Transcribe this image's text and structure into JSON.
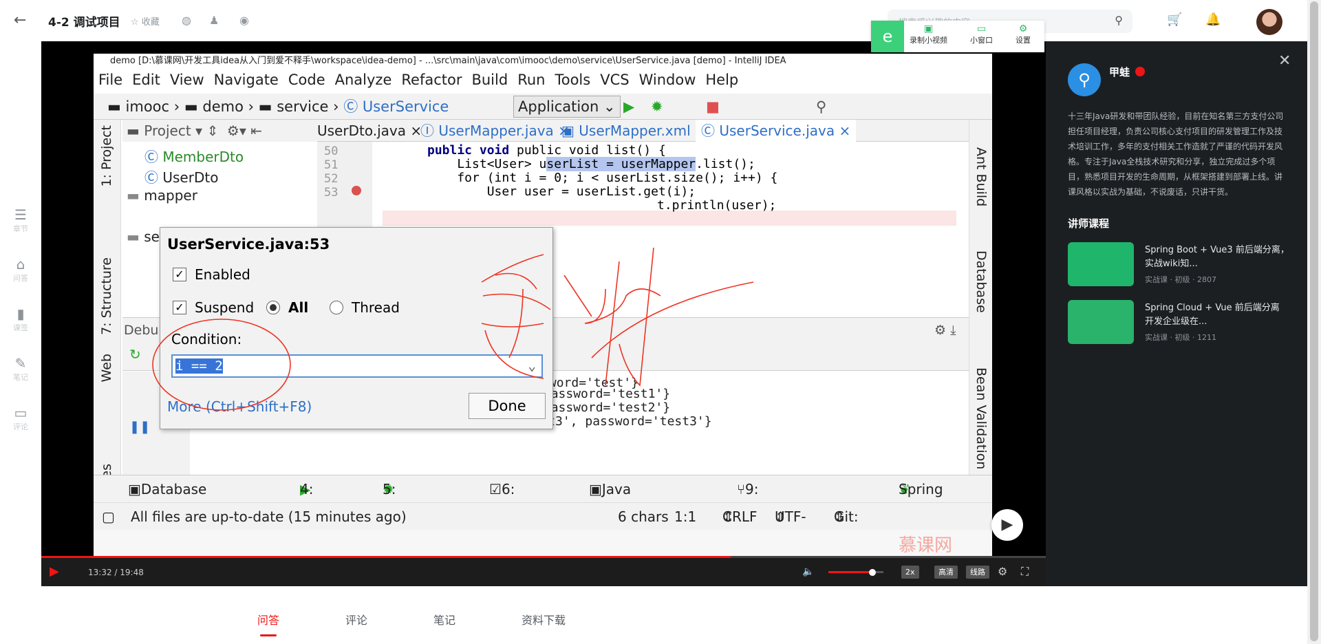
{
  "header": {
    "title": "4-2 调试项目",
    "collect": "☆ 收藏",
    "search_placeholder": "搜索感兴趣的内容"
  },
  "recorder": {
    "record": "录制小视频",
    "mini": "小窗口",
    "settings": "设置"
  },
  "left_sidebar": [
    {
      "label": "章节",
      "icon": "chapter-icon"
    },
    {
      "label": "问答",
      "icon": "qa-icon"
    },
    {
      "label": "课签",
      "icon": "tag-icon"
    },
    {
      "label": "笔记",
      "icon": "note-icon"
    },
    {
      "label": "评论",
      "icon": "comment-icon"
    }
  ],
  "ide": {
    "window_title": "demo [D:\\慕课网\\开发工具idea从入门到爱不释手\\workspace\\idea-demo] - ...\\src\\main\\java\\com\\imooc\\demo\\service\\UserService.java [demo] - IntelliJ IDEA",
    "menu": [
      "File",
      "Edit",
      "View",
      "Navigate",
      "Code",
      "Analyze",
      "Refactor",
      "Build",
      "Run",
      "Tools",
      "VCS",
      "Window",
      "Help"
    ],
    "breadcrumb": [
      "imooc",
      "demo",
      "service",
      "UserService"
    ],
    "run_config": "Application",
    "project_label": "Project",
    "tabs": [
      "UserDto.java",
      "UserMapper.java",
      "UserMapper.xml",
      "UserService.java"
    ],
    "tree": [
      "MemberDto",
      "UserDto",
      "mapper",
      "se"
    ],
    "line_numbers": [
      "50",
      "51",
      "52",
      "53"
    ],
    "code": {
      "l50": "public void list() {",
      "l51a": "    List<User> u",
      "l51b": "serList = ",
      "l51c": "userMapper",
      "l51d": ".list();",
      "l52": "    for (int i = 0; i < userList.size(); i++) {",
      "l53": "        User user = userList.get(i);",
      "l54": "t.println(user);"
    },
    "debug_label": "Debu",
    "console": [
      "试', password='test'}",
      "est1', password='test1'}",
      "est2', password='test2'}",
      "User{id='00000003', loginName='test3', name='test3', password='test3'}"
    ],
    "left_strip": [
      "1: Project",
      "7: Structure",
      "Web",
      "orites"
    ],
    "right_strip": [
      "Ant Build",
      "Database",
      "Bean Validation"
    ],
    "bottom_tabs": [
      "Database Console",
      "4: Run",
      "5: Debug",
      "6: TODO",
      "Java Enterprise",
      "9: Version Control",
      "Spring"
    ],
    "status": {
      "message": "All files are up-to-date (15 minutes ago)",
      "chars": "6 chars",
      "pos": "1:1",
      "crlf": "CRLF",
      "enc": "UTF-8",
      "git": "Git: master"
    },
    "watermark": "慕课网"
  },
  "breakpoint_dialog": {
    "title": "UserService.java:53",
    "enabled": "Enabled",
    "suspend": "Suspend",
    "all": "All",
    "thread": "Thread",
    "condition_label": "Condition:",
    "condition_value": "i == 2",
    "more": "More (Ctrl+Shift+F8)",
    "done": "Done"
  },
  "player": {
    "time": "13:32 / 19:48",
    "progress": 0.686,
    "volume": 0.8,
    "speed": "2x",
    "quality": "高清",
    "line": "线路"
  },
  "teacher": {
    "name": "甲蛙",
    "bio": "十三年Java研发和带团队经验，目前在知名第三方支付公司担任项目经理，负责公司核心支付项目的研发管理工作及技术培训工作，多年的支付相关工作造就了严谨的代码开发风格。专注于Java全栈技术研究和分享，独立完成过多个项目，熟悉项目开发的生命周期，从框架搭建到部署上线。讲课风格以实战为基础，不说废话，只讲干货。",
    "courses_heading": "讲师课程",
    "courses": [
      {
        "title": "Spring Boot + Vue3 前后端分离，实战wiki知...",
        "meta": "实战课 · 初级 · 2807"
      },
      {
        "title": "Spring Cloud + Vue 前后端分离 开发企业级在...",
        "meta": "实战课 · 初级 · 1211"
      }
    ]
  },
  "bottom_tabs": [
    "问答",
    "评论",
    "笔记",
    "资料下载"
  ],
  "colors": {
    "accent": "#f01414",
    "green": "#1fb56a",
    "ide_blue": "#2d6fc7"
  }
}
